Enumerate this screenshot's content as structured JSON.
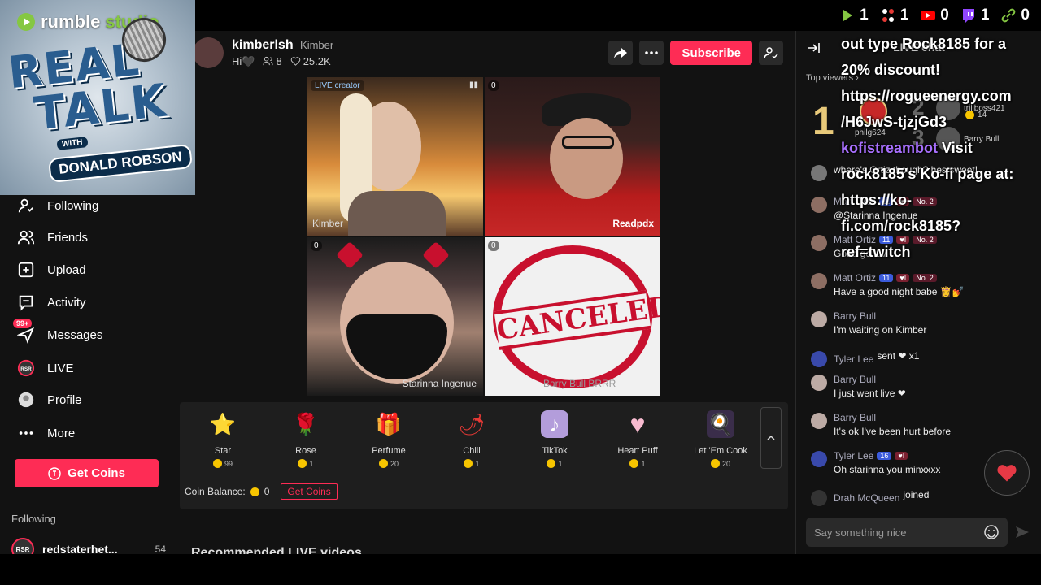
{
  "stats": [
    {
      "icon": "rumble-icon",
      "value": "1",
      "color": "#85c742"
    },
    {
      "icon": "kick-icon",
      "value": "1",
      "color": "#e53935"
    },
    {
      "icon": "youtube-icon",
      "value": "0",
      "color": "#ff0000"
    },
    {
      "icon": "twitch-icon",
      "value": "1",
      "color": "#9146ff"
    },
    {
      "icon": "link-icon",
      "value": "0",
      "color": "#85c742"
    }
  ],
  "logo": {
    "brand": "rumble",
    "studio": "studio",
    "line1": "REAL",
    "line2": "TALK",
    "with": "WITH",
    "host": "DONALD ROBSON"
  },
  "sidebar": {
    "items": [
      {
        "label": "Following",
        "icon": "following-icon"
      },
      {
        "label": "Friends",
        "icon": "friends-icon"
      },
      {
        "label": "Upload",
        "icon": "upload-icon"
      },
      {
        "label": "Activity",
        "icon": "activity-icon"
      },
      {
        "label": "Messages",
        "icon": "messages-icon",
        "badge": "99+"
      },
      {
        "label": "LIVE",
        "icon": "live-icon"
      },
      {
        "label": "Profile",
        "icon": "profile-icon"
      },
      {
        "label": "More",
        "icon": "more-icon"
      }
    ],
    "get_coins": "Get Coins",
    "following_header": "Following",
    "following_user": {
      "name": "redstaterhet...",
      "count": "54",
      "avatar_text": "RSR"
    }
  },
  "streamer": {
    "name": "kimberlsh",
    "nickname": "Kimber",
    "bio": "Hi🖤",
    "viewers": "8",
    "likes": "25.2K",
    "subscribe": "Subscribe"
  },
  "tiles": [
    {
      "label": "Kimber",
      "badge": "LIVE creator"
    },
    {
      "label": "Readpdx",
      "badge": "0"
    },
    {
      "label": "Starinna Ingenue",
      "badge": "0"
    },
    {
      "label": "",
      "badge": "0",
      "stamp": "CANCELED",
      "caption": "Barry Bull BRRR"
    }
  ],
  "gifts": [
    {
      "name": "Star",
      "price": "99",
      "icon": "⭐"
    },
    {
      "name": "Rose",
      "price": "1",
      "icon": "🌹"
    },
    {
      "name": "Perfume",
      "price": "20",
      "icon": "🎁"
    },
    {
      "name": "Chili",
      "price": "1",
      "icon": "🌶"
    },
    {
      "name": "TikTok",
      "price": "1",
      "icon": "♪"
    },
    {
      "name": "Heart Puff",
      "price": "1",
      "icon": "♥"
    },
    {
      "name": "Let 'Em Cook",
      "price": "20",
      "icon": "🍳"
    }
  ],
  "balance": {
    "label": "Coin Balance:",
    "value": "0",
    "get_coins": "Get Coins"
  },
  "recommended": "Recommended LIVE videos",
  "chat": {
    "title": "LIVE chat",
    "top_viewers": "Top viewers",
    "viewer1": {
      "rank": "1"
    },
    "viewer2": {
      "rank": "2",
      "name": "trillboss421",
      "coins": "14"
    },
    "viewer3": {
      "rank": "3",
      "name": "Barry Bull"
    },
    "viewer_extra": {
      "name": "philg624"
    },
    "messages": [
      {
        "name": "",
        "text": "where's Ortiz though? hes sweet!"
      },
      {
        "name": "Matt Ortiz",
        "lvl": "11",
        "no": "No. 2",
        "text": "@Starinna Ingenue"
      },
      {
        "name": "Matt Ortiz",
        "lvl": "11",
        "no": "No. 2",
        "text": "Gotta go luv"
      },
      {
        "name": "Matt Ortiz",
        "lvl": "11",
        "no": "No. 2",
        "text": "Have a good night babe 👸💅"
      },
      {
        "name": "Barry Bull",
        "text": "I'm waiting on Kimber"
      },
      {
        "name": "Tyler Lee",
        "text": "sent ❤ x1"
      },
      {
        "name": "Barry Bull",
        "text": "I just went live ❤"
      },
      {
        "name": "Barry Bull",
        "text": "It's ok I've been hurt before"
      },
      {
        "name": "Tyler Lee",
        "lvl": "16",
        "text": "Oh starinna you minxxxx"
      },
      {
        "name": "Drah McQueen",
        "text": "joined"
      }
    ],
    "input_placeholder": "Say something nice"
  },
  "overlay": {
    "line1": "out type Rock8185 for a",
    "line2": "20% discount!",
    "line3": "https://rogueenergy.com",
    "line4": "/H6JwS-tjzjGd3",
    "bot": "kofistreambot",
    "line5": "Visit",
    "line6": "rock8185's Ko-fi page at:",
    "line7": "https://ko-",
    "line8": "fi.com/rock8185?",
    "line9": "ref=twitch"
  }
}
